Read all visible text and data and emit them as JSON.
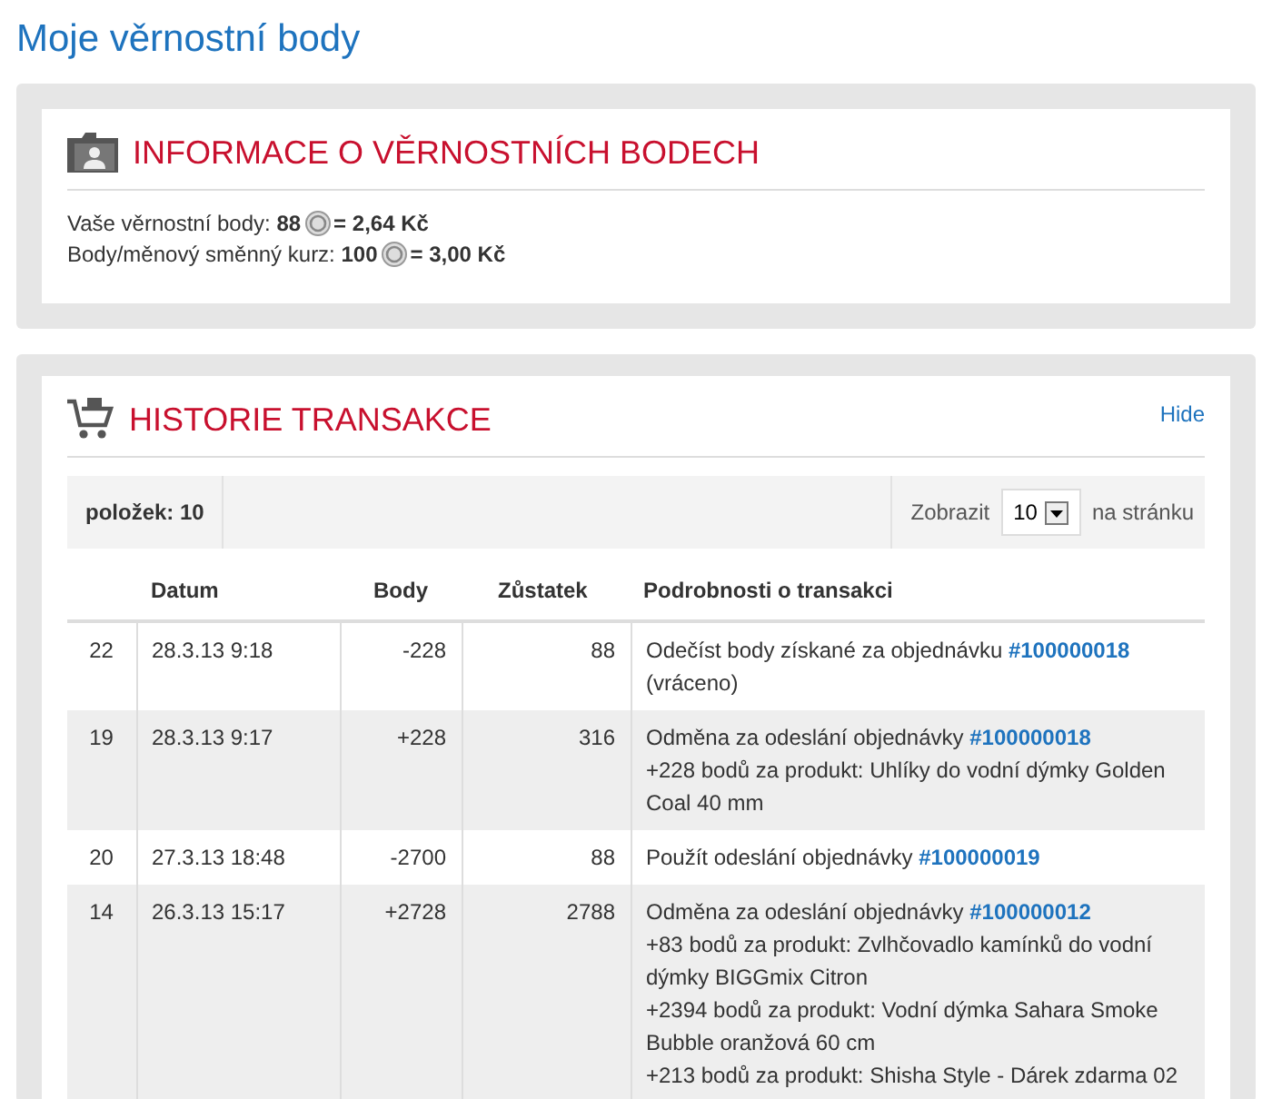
{
  "page_title": "Moje věrnostní body",
  "info": {
    "title": "INFORMACE O VĚRNOSTNÍCH BODECH",
    "lines": [
      {
        "label": "Vaše věrnostní body: ",
        "points": "88",
        "value": "= 2,64 Kč"
      },
      {
        "label": "Body/měnový směnný kurz: ",
        "points": "100",
        "value": "= 3,00 Kč"
      }
    ]
  },
  "history": {
    "title": "HISTORIE TRANSAKCE",
    "hide_link": "Hide",
    "count": "položek: 10",
    "show_label": "Zobrazit",
    "per_page": "10",
    "per_page_suffix": "na stránku",
    "columns": [
      "Datum",
      "Body",
      "Zůstatek",
      "Podrobnosti o transakci"
    ],
    "rows": [
      {
        "id": "22",
        "date": "28.3.13 9:18",
        "points": "-228",
        "balance": "88",
        "details": [
          {
            "text": "Odečíst body získané za objednávku ",
            "link": "#100000018",
            "after": " (vráceno)"
          }
        ]
      },
      {
        "id": "19",
        "date": "28.3.13 9:17",
        "points": "+228",
        "balance": "316",
        "details": [
          {
            "text": "Odměna za odeslání objednávky ",
            "link": "#100000018"
          },
          {
            "text": "+228 bodů za produkt: Uhlíky do vodní dýmky Golden Coal 40 mm"
          }
        ]
      },
      {
        "id": "20",
        "date": "27.3.13 18:48",
        "points": "-2700",
        "balance": "88",
        "details": [
          {
            "text": "Použít odeslání objednávky ",
            "link": "#100000019"
          }
        ]
      },
      {
        "id": "14",
        "date": "26.3.13 15:17",
        "points": "+2728",
        "balance": "2788",
        "details": [
          {
            "text": "Odměna za odeslání objednávky ",
            "link": "#100000012"
          },
          {
            "text": "+83 bodů za produkt: Zvlhčovadlo kamínků do vodní dýmky BIGGmix Citron"
          },
          {
            "text": "+2394 bodů za produkt: Vodní dýmka Sahara Smoke Bubble oranžová 60 cm"
          },
          {
            "text": "+213 bodů za produkt: Shisha Style - Dárek zdarma 02"
          }
        ]
      }
    ]
  }
}
